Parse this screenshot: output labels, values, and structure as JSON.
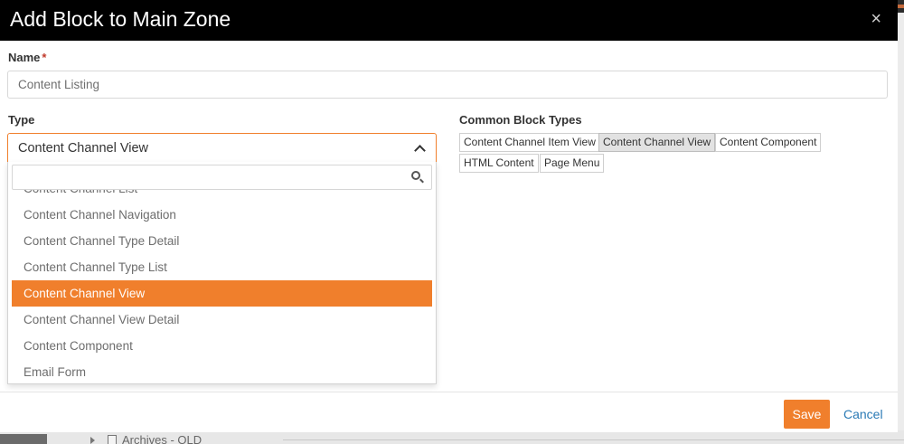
{
  "modal": {
    "title": "Add Block to Main Zone",
    "close_glyph": "×"
  },
  "name_field": {
    "label": "Name",
    "required_marker": "*",
    "value": "Content Listing"
  },
  "type_field": {
    "label": "Type",
    "selected": "Content Channel View",
    "search_value": "",
    "options": [
      "Content Channel List",
      "Content Channel Navigation",
      "Content Channel Type Detail",
      "Content Channel Type List",
      "Content Channel View",
      "Content Channel View Detail",
      "Content Component",
      "Email Form"
    ],
    "selected_index": 4
  },
  "common_block_types": {
    "label": "Common Block Types",
    "items": [
      {
        "label": "Content Channel Item View",
        "active": false
      },
      {
        "label": "Content Channel View",
        "active": true
      },
      {
        "label": "Content Component",
        "active": false
      },
      {
        "label": "HTML Content",
        "active": false
      },
      {
        "label": "Page Menu",
        "active": false
      }
    ]
  },
  "footer": {
    "save_label": "Save",
    "cancel_label": "Cancel"
  },
  "background": {
    "tree_item": "Archives - OLD"
  },
  "colors": {
    "accent": "#f07f2c",
    "header_bg": "#000000",
    "link": "#2a7ab5",
    "required": "#c0392b"
  },
  "icons": {
    "close": "close-icon",
    "chevron": "chevron-up-icon",
    "search": "search-icon"
  }
}
